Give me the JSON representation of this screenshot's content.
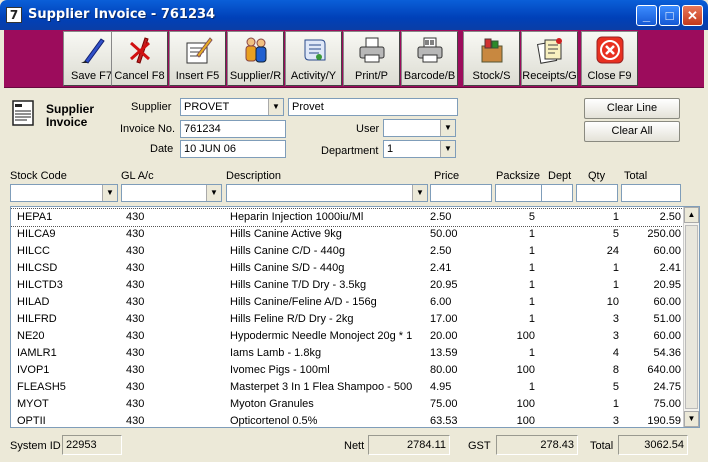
{
  "window": {
    "title": "Supplier Invoice - 761234",
    "icon_glyph": "7"
  },
  "toolbar": {
    "buttons": [
      {
        "label": "Save F7",
        "icon": "pen-icon"
      },
      {
        "label": "Cancel F8",
        "icon": "cancel-pen-icon"
      },
      {
        "label": "Insert F5",
        "icon": "insert-icon"
      },
      {
        "label": "Supplier/R",
        "icon": "people-icon"
      },
      {
        "label": "Activity/Y",
        "icon": "scroll-icon"
      },
      {
        "label": "Print/P",
        "icon": "printer-icon"
      },
      {
        "label": "Barcode/B",
        "icon": "barcode-printer-icon"
      },
      {
        "label": "Stock/S",
        "icon": "box-icon"
      },
      {
        "label": "Receipts/G",
        "icon": "receipt-icon"
      },
      {
        "label": "Close F9",
        "icon": "close-circle-icon"
      }
    ]
  },
  "header": {
    "title": "Supplier Invoice",
    "supplier_label": "Supplier",
    "supplier_code": "PROVET",
    "supplier_name": "Provet",
    "invoice_label": "Invoice No.",
    "invoice_no": "761234",
    "date_label": "Date",
    "date": "10 JUN 06",
    "user_label": "User",
    "user": "",
    "department_label": "Department",
    "department": "1",
    "clear_line": "Clear Line",
    "clear_all": "Clear All"
  },
  "columns": {
    "stock_code": "Stock Code",
    "gl": "GL A/c",
    "description": "Description",
    "price": "Price",
    "packsize": "Packsize",
    "dept": "Dept",
    "qty": "Qty",
    "total": "Total"
  },
  "rows": [
    {
      "code": "HEPA1",
      "gl": "430",
      "desc": "Heparin Injection 1000iu/Ml",
      "price": "2.50",
      "pack": "5",
      "dept": "",
      "qty": "1",
      "total": "2.50"
    },
    {
      "code": "HILCA9",
      "gl": "430",
      "desc": "Hills Canine Active 9kg",
      "price": "50.00",
      "pack": "1",
      "dept": "",
      "qty": "5",
      "total": "250.00"
    },
    {
      "code": "HILCC",
      "gl": "430",
      "desc": "Hills Canine C/D - 440g",
      "price": "2.50",
      "pack": "1",
      "dept": "",
      "qty": "24",
      "total": "60.00"
    },
    {
      "code": "HILCSD",
      "gl": "430",
      "desc": "Hills Canine S/D - 440g",
      "price": "2.41",
      "pack": "1",
      "dept": "",
      "qty": "1",
      "total": "2.41"
    },
    {
      "code": "HILCTD3",
      "gl": "430",
      "desc": "Hills Canine T/D Dry - 3.5kg",
      "price": "20.95",
      "pack": "1",
      "dept": "",
      "qty": "1",
      "total": "20.95"
    },
    {
      "code": "HILAD",
      "gl": "430",
      "desc": "Hills Canine/Feline A/D - 156g",
      "price": "6.00",
      "pack": "1",
      "dept": "",
      "qty": "10",
      "total": "60.00"
    },
    {
      "code": "HILFRD",
      "gl": "430",
      "desc": "Hills Feline R/D Dry - 2kg",
      "price": "17.00",
      "pack": "1",
      "dept": "",
      "qty": "3",
      "total": "51.00"
    },
    {
      "code": "NE20",
      "gl": "430",
      "desc": "Hypodermic Needle Monoject 20g * 1",
      "price": "20.00",
      "pack": "100",
      "dept": "",
      "qty": "3",
      "total": "60.00"
    },
    {
      "code": "IAMLR1",
      "gl": "430",
      "desc": "Iams Lamb - 1.8kg",
      "price": "13.59",
      "pack": "1",
      "dept": "",
      "qty": "4",
      "total": "54.36"
    },
    {
      "code": "IVOP1",
      "gl": "430",
      "desc": "Ivomec Pigs - 100ml",
      "price": "80.00",
      "pack": "100",
      "dept": "",
      "qty": "8",
      "total": "640.00"
    },
    {
      "code": "FLEASH5",
      "gl": "430",
      "desc": "Masterpet 3 In 1 Flea Shampoo - 500",
      "price": "4.95",
      "pack": "1",
      "dept": "",
      "qty": "5",
      "total": "24.75"
    },
    {
      "code": "MYOT",
      "gl": "430",
      "desc": "Myoton Granules",
      "price": "75.00",
      "pack": "100",
      "dept": "",
      "qty": "1",
      "total": "75.00"
    },
    {
      "code": "OPTII",
      "gl": "430",
      "desc": "Opticortenol 0.5%",
      "price": "63.53",
      "pack": "100",
      "dept": "",
      "qty": "3",
      "total": "190.59"
    }
  ],
  "footer": {
    "system_id_label": "System ID",
    "system_id": "22953",
    "nett_label": "Nett",
    "nett": "2784.11",
    "gst_label": "GST",
    "gst": "278.43",
    "total_label": "Total",
    "total": "3062.54"
  },
  "colors": {
    "toolbar_bg": "#9c0c5c",
    "titlebar": "#0a5fd8",
    "window_bg": "#ece9d8"
  }
}
